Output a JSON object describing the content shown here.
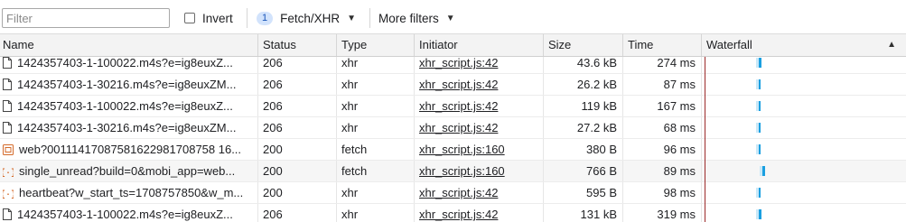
{
  "toolbar": {
    "filter_placeholder": "Filter",
    "invert_label": "Invert",
    "fetch_count": "1",
    "fetch_label": "Fetch/XHR",
    "more_filters_label": "More filters"
  },
  "columns": {
    "name": "Name",
    "status": "Status",
    "type": "Type",
    "initiator": "Initiator",
    "size": "Size",
    "time": "Time",
    "waterfall": "Waterfall"
  },
  "rows": [
    {
      "icon": "file-icon",
      "name": "1424357403-1-100022.m4s?e=ig8euxZ...",
      "status": "206",
      "type": "xhr",
      "initiator": "xhr_script.js:42",
      "size": "43.6 kB",
      "time": "274 ms",
      "wf_ms": 3
    },
    {
      "icon": "file-icon",
      "name": "1424357403-1-30216.m4s?e=ig8euxZM...",
      "status": "206",
      "type": "xhr",
      "initiator": "xhr_script.js:42",
      "size": "26.2 kB",
      "time": "87 ms",
      "wf_ms": 2
    },
    {
      "icon": "file-icon",
      "name": "1424357403-1-100022.m4s?e=ig8euxZ...",
      "status": "206",
      "type": "xhr",
      "initiator": "xhr_script.js:42",
      "size": "119 kB",
      "time": "167 ms",
      "wf_ms": 2
    },
    {
      "icon": "file-icon",
      "name": "1424357403-1-30216.m4s?e=ig8euxZM...",
      "status": "206",
      "type": "xhr",
      "initiator": "xhr_script.js:42",
      "size": "27.2 kB",
      "time": "68 ms",
      "wf_ms": 2
    },
    {
      "icon": "fetch-doc-icon",
      "name": "web?00111417087581622981708758 16...",
      "status": "200",
      "type": "fetch",
      "initiator": "xhr_script.js:160",
      "size": "380 B",
      "time": "96 ms",
      "wf_ms": 2
    },
    {
      "icon": "fetch-braces-icon",
      "name": "single_unread?build=0&mobi_app=web...",
      "status": "200",
      "type": "fetch",
      "initiator": "xhr_script.js:160",
      "size": "766 B",
      "time": "89 ms",
      "wf_ms": 3
    },
    {
      "icon": "fetch-braces-icon",
      "name": "heartbeat?w_start_ts=1708757850&w_m...",
      "status": "200",
      "type": "xhr",
      "initiator": "xhr_script.js:42",
      "size": "595 B",
      "time": "98 ms",
      "wf_ms": 2
    },
    {
      "icon": "file-icon",
      "name": "1424357403-1-100022.m4s?e=ig8euxZ...",
      "status": "206",
      "type": "xhr",
      "initiator": "xhr_script.js:42",
      "size": "131 kB",
      "time": "319 ms",
      "wf_ms": 3
    }
  ],
  "colors": {
    "accent": "#1a73e8",
    "waterfall_bar": "#1a9fe0",
    "load_line": "#9b2a2a"
  }
}
